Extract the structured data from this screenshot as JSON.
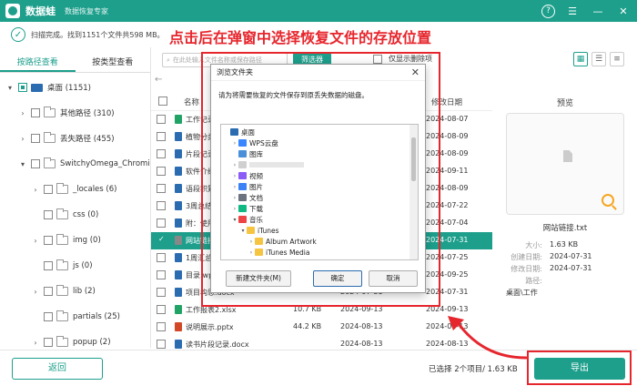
{
  "app": {
    "name": "数据蛙",
    "subtitle": "数据恢复专家"
  },
  "status": {
    "scan_text": "扫描完成。找到1151个文件共598 MB。"
  },
  "annotation": "点击后在弹窗中选择恢复文件的存放位置",
  "tabs": [
    "按路径查看",
    "按类型查看"
  ],
  "tree": [
    {
      "label": "桌面 (1151)",
      "level": 0,
      "arrow": "▾",
      "check": "partial",
      "icon": "desktop"
    },
    {
      "label": "其他路径 (310)",
      "level": 1,
      "arrow": "›",
      "check": "none",
      "icon": "folder"
    },
    {
      "label": "丢失路径 (455)",
      "level": 1,
      "arrow": "›",
      "check": "none",
      "icon": "folder"
    },
    {
      "label": "SwitchyOmega_Chromium",
      "level": 1,
      "arrow": "▾",
      "check": "none",
      "icon": "folder"
    },
    {
      "label": "_locales (6)",
      "level": 2,
      "arrow": "›",
      "check": "none",
      "icon": "folder"
    },
    {
      "label": "css (0)",
      "level": 2,
      "arrow": "",
      "check": "none",
      "icon": "folder"
    },
    {
      "label": "img (0)",
      "level": 2,
      "arrow": "›",
      "check": "none",
      "icon": "folder"
    },
    {
      "label": "js (0)",
      "level": 2,
      "arrow": "",
      "check": "none",
      "icon": "folder"
    },
    {
      "label": "lib (2)",
      "level": 2,
      "arrow": "›",
      "check": "none",
      "icon": "folder"
    },
    {
      "label": "partials (25)",
      "level": 2,
      "arrow": "",
      "check": "none",
      "icon": "folder"
    },
    {
      "label": "popup (2)",
      "level": 2,
      "arrow": "›",
      "check": "none",
      "icon": "folder"
    }
  ],
  "toolbar": {
    "search_placeholder": "在此处输入文件名称或保存路径",
    "filter_label": "筛选器",
    "deleted_only_label": "仅显示删除项"
  },
  "table": {
    "headers": {
      "name": "名称",
      "date": "修改日期"
    },
    "rows": [
      {
        "name": "工作记录表.xlsx",
        "size": "",
        "date": "2024-08-07",
        "mdate": "2024-08-07",
        "type": "xlsx",
        "selected": false
      },
      {
        "name": "植物分类.docx",
        "size": "",
        "date": "2024-08-09",
        "mdate": "2024-08-09",
        "type": "docx",
        "selected": false
      },
      {
        "name": "片段记录.docx",
        "size": "",
        "date": "2024-08-09",
        "mdate": "2024-08-09",
        "type": "docx",
        "selected": false
      },
      {
        "name": "软件介绍.docx",
        "size": "",
        "date": "2024-09-11",
        "mdate": "2024-09-11",
        "type": "docx",
        "selected": false
      },
      {
        "name": "语段积累.docx",
        "size": "",
        "date": "2024-08-09",
        "mdate": "2024-08-09",
        "type": "docx",
        "selected": false
      },
      {
        "name": "3周总结.docx",
        "size": "",
        "date": "2024-07-22",
        "mdate": "2024-07-22",
        "type": "docx",
        "selected": false
      },
      {
        "name": "附：使用注意.docx",
        "size": "",
        "date": "2024-07-04",
        "mdate": "2024-07-04",
        "type": "docx",
        "selected": false
      },
      {
        "name": "网站链接.txt",
        "size": "",
        "date": "2024-07-31",
        "mdate": "2024-07-31",
        "type": "txt",
        "selected": true
      },
      {
        "name": "1周汇总.docx",
        "size": "",
        "date": "2024-07-25",
        "mdate": "2024-07-25",
        "type": "docx",
        "selected": false
      },
      {
        "name": "目录.wps",
        "size": "",
        "date": "2024-09-25",
        "mdate": "2024-09-25",
        "type": "wps",
        "selected": false
      },
      {
        "name": "项目构思.docx",
        "size": "",
        "date": "2024-07-31",
        "mdate": "2024-07-31",
        "type": "docx",
        "selected": false
      },
      {
        "name": "工作报表2.xlsx",
        "size": "10.7 KB",
        "date": "2024-09-13",
        "mdate": "2024-09-13",
        "type": "xlsx",
        "selected": false
      },
      {
        "name": "说明展示.pptx",
        "size": "44.2 KB",
        "date": "2024-08-13",
        "mdate": "2024-08-13",
        "type": "pptx",
        "selected": false
      },
      {
        "name": "读书片段记录.docx",
        "size": "",
        "date": "2024-08-13",
        "mdate": "2024-08-13",
        "type": "docx",
        "selected": false
      }
    ]
  },
  "preview": {
    "title": "预览",
    "filename": "网站链接.txt",
    "fields": [
      {
        "label": "大小:",
        "value": "1.63 KB"
      },
      {
        "label": "创建日期:",
        "value": "2024-07-31"
      },
      {
        "label": "修改日期:",
        "value": "2024-07-31"
      },
      {
        "label": "路径:",
        "value": ""
      },
      {
        "label": "",
        "value": "桌面\\工作"
      }
    ]
  },
  "dialog": {
    "title": "浏览文件夹",
    "message": "请为将需要恢复的文件保存到原丢失数据的磁盘。",
    "tree": [
      {
        "label": "桌面",
        "arrow": "",
        "indent": 0,
        "color": "#2b6cb0"
      },
      {
        "label": "WPS云盘",
        "arrow": "›",
        "indent": 1,
        "color": "#3a86ff"
      },
      {
        "label": "图库",
        "arrow": "",
        "indent": 1,
        "color": "#4a90d9"
      },
      {
        "label": "",
        "arrow": "›",
        "indent": 1,
        "color": "#d0d0d0"
      },
      {
        "label": "视频",
        "arrow": "›",
        "indent": 1,
        "color": "#8b5cf6"
      },
      {
        "label": "图片",
        "arrow": "›",
        "indent": 1,
        "color": "#3b82f6"
      },
      {
        "label": "文档",
        "arrow": "›",
        "indent": 1,
        "color": "#6b7280"
      },
      {
        "label": "下载",
        "arrow": "›",
        "indent": 1,
        "color": "#10b981"
      },
      {
        "label": "音乐",
        "arrow": "▾",
        "indent": 1,
        "color": "#ef4444"
      },
      {
        "label": "iTunes",
        "arrow": "▾",
        "indent": 2,
        "color": "#f5c542"
      },
      {
        "label": "Album Artwork",
        "arrow": "›",
        "indent": 3,
        "color": "#f5c542"
      },
      {
        "label": "iTunes Media",
        "arrow": "›",
        "indent": 3,
        "color": "#f5c542"
      }
    ],
    "buttons": {
      "new_folder": "新建文件夹(M)",
      "ok": "确定",
      "cancel": "取消"
    }
  },
  "bottom": {
    "back_label": "返回",
    "selected_info": "已选择 2个项目/ 1.63 KB",
    "export_label": "导出"
  }
}
